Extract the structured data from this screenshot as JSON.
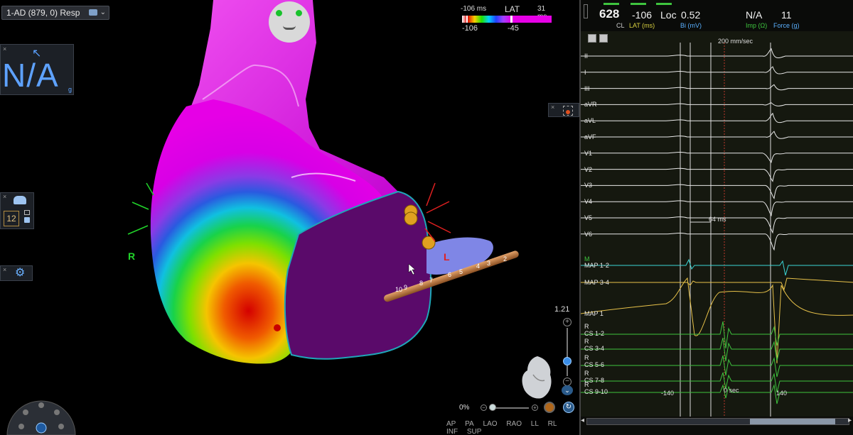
{
  "viewport": {
    "map_selector": "1-AD (879, 0) Resp",
    "na_panel": {
      "value": "N/A",
      "unit": "g"
    },
    "side_button_value": "12",
    "lat_scale": {
      "min_label": "-106 ms",
      "title": "LAT",
      "max_label": "31 ms",
      "left_value": "-106",
      "marker_value": "-45"
    },
    "orientation_labels": {
      "right": "R",
      "left": "L"
    },
    "catheter_electrodes": [
      "10",
      "9",
      "8",
      "7",
      "6",
      "5",
      "4",
      "3",
      "2"
    ],
    "zoom_value": "1.21",
    "transparency": "0%",
    "view_buttons": [
      "AP",
      "PA",
      "LAO",
      "RAO",
      "LL",
      "RL",
      "INF",
      "SUP"
    ],
    "colors": {
      "lat_early": "#d60000",
      "lat_late": "#e600e6",
      "shell": "#5a0a6a"
    }
  },
  "ecg": {
    "header": {
      "cl_value": "628",
      "cl_label": "CL",
      "lat_value": "-106",
      "lat_label": "LAT (ms)",
      "loc_label": "Loc",
      "bi_value": "0.52",
      "bi_label": "Bi (mV)",
      "imp_value": "N/A",
      "imp_label": "Imp (Ω)",
      "force_value": "11",
      "force_label": "Force (g)"
    },
    "speed": "200 mm/sec",
    "surface_leads": [
      "II",
      "I",
      "III",
      "aVR",
      "aVL",
      "aVF",
      "V1",
      "V2",
      "V3",
      "V4",
      "V5",
      "V6"
    ],
    "measure_label": "64 ms",
    "m_marker": "M",
    "map_leads": [
      "MAP 1-2",
      "MAP 3-4",
      "MAP 1"
    ],
    "cs_leads": [
      "CS 1-2",
      "CS 3-4",
      "CS 5-6",
      "CS 7-8",
      "CS 9-10"
    ],
    "cs_prefix": "R",
    "time_labels": {
      "left": "-140",
      "center": "0 sec",
      "right": "140"
    },
    "colors": {
      "surface": "#e8e8e8",
      "map12": "#3ad6d6",
      "map34": "#e8c24a",
      "cs": "#3ec43e",
      "ref_line": "#c0392b"
    }
  }
}
